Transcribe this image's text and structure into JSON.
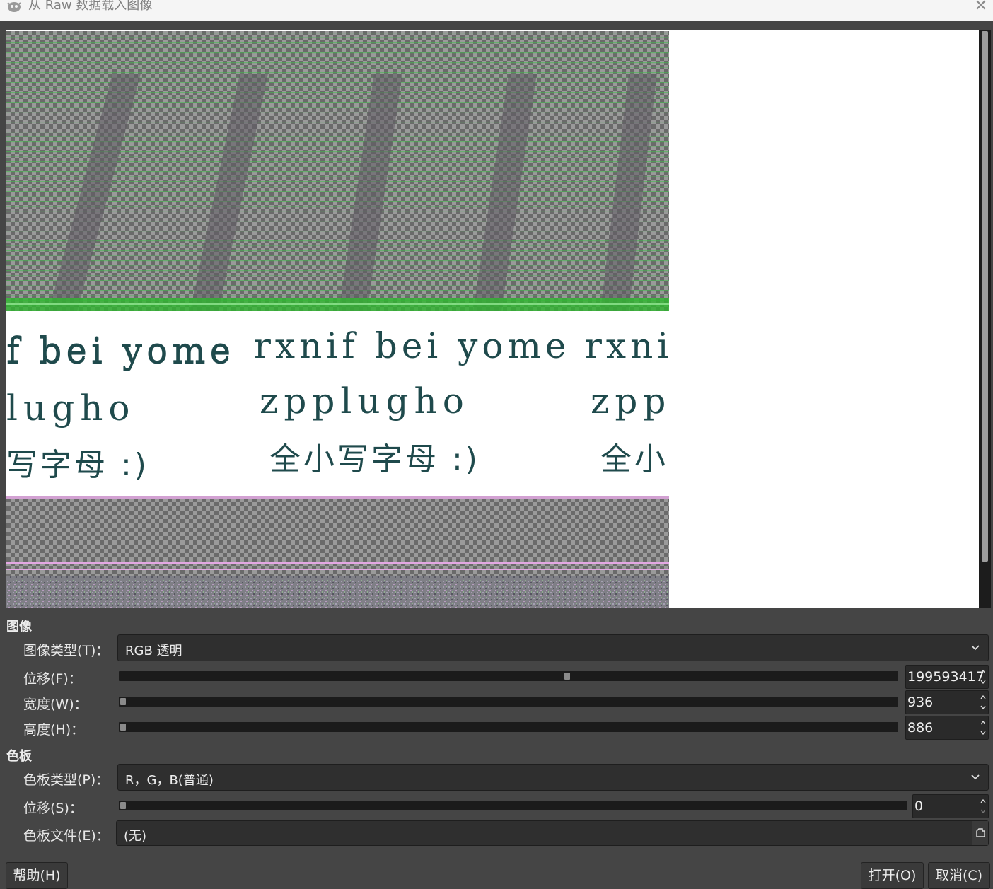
{
  "window": {
    "title": "从 Raw 数据载入图像"
  },
  "preview": {
    "handwriting_rows": [
      [
        "f bei yome",
        "rxnif bei yome",
        "rxni"
      ],
      [
        "lugho",
        "zpplugho",
        "zpp"
      ],
      [
        "写字母 :)",
        "全小写字母 :)",
        "全小"
      ]
    ]
  },
  "image_section": {
    "label": "图像",
    "type": {
      "label": "图像类型(T)：",
      "value": "RGB 透明"
    },
    "offset": {
      "label": "位移(F)：",
      "value": "199593417",
      "fraction": 0.576
    },
    "width": {
      "label": "宽度(W)：",
      "value": "936",
      "fraction": 0.0
    },
    "height": {
      "label": "高度(H)：",
      "value": "886",
      "fraction": 0.0
    }
  },
  "palette_section": {
    "label": "色板",
    "type": {
      "label": "色板类型(P)：",
      "value": "R，G，B(普通)"
    },
    "offset": {
      "label": "位移(S)：",
      "value": "0",
      "fraction": 0.0
    },
    "file": {
      "label": "色板文件(E)：",
      "value": "(无)"
    }
  },
  "buttons": {
    "help": "帮助(H)",
    "open": "打开(O)",
    "cancel": "取消(C)"
  }
}
